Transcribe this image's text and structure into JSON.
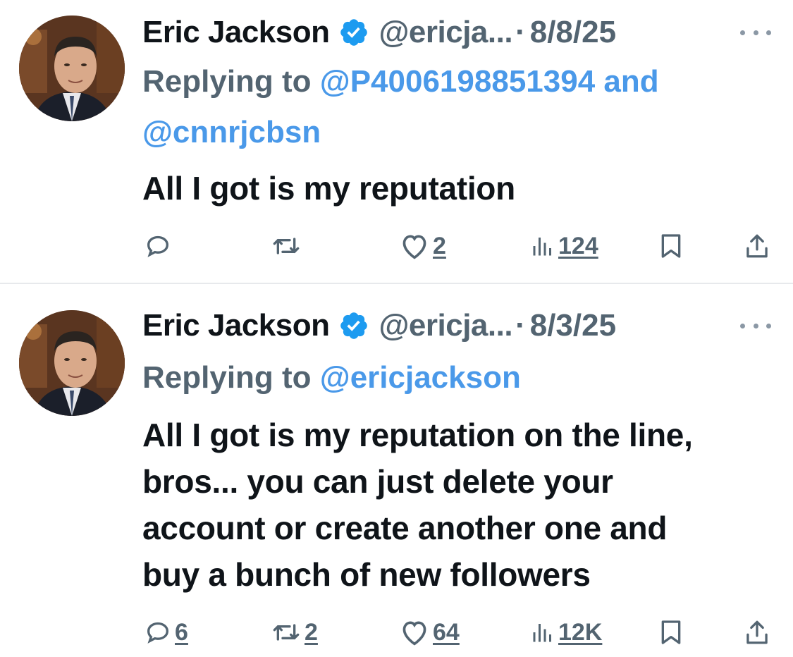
{
  "tweets": [
    {
      "author_name": "Eric Jackson",
      "handle": "@ericja...",
      "separator": "·",
      "date": "8/8/25",
      "replying_prefix": "Replying to",
      "reply_mentions_line1": "@P4006198851394 and",
      "reply_mentions_line2": "@cnnrjcbsn",
      "text": "All I got is my reputation",
      "counts": {
        "replies": "",
        "retweets": "",
        "likes": "2",
        "views": "124"
      }
    },
    {
      "author_name": "Eric Jackson",
      "handle": "@ericja...",
      "separator": "·",
      "date": "8/3/25",
      "replying_prefix": "Replying to",
      "reply_mentions_line1": "@ericjackson",
      "text_lines": [
        "All I got is my reputation on the line,",
        "bros... you can just delete your",
        "account or create another one and",
        "buy a bunch of new followers"
      ],
      "counts": {
        "replies": "6",
        "retweets": "2",
        "likes": "64",
        "views": "12K"
      }
    }
  ],
  "colors": {
    "primary_text": "#0f1419",
    "secondary_text": "#536471",
    "mention": "#4a99e9",
    "verified_badge": "#1d9bf0",
    "divider": "#e7e9ec"
  },
  "icons": [
    "verified-badge-icon",
    "more-icon",
    "reply-icon",
    "retweet-icon",
    "like-icon",
    "views-icon",
    "bookmark-icon",
    "share-icon"
  ]
}
